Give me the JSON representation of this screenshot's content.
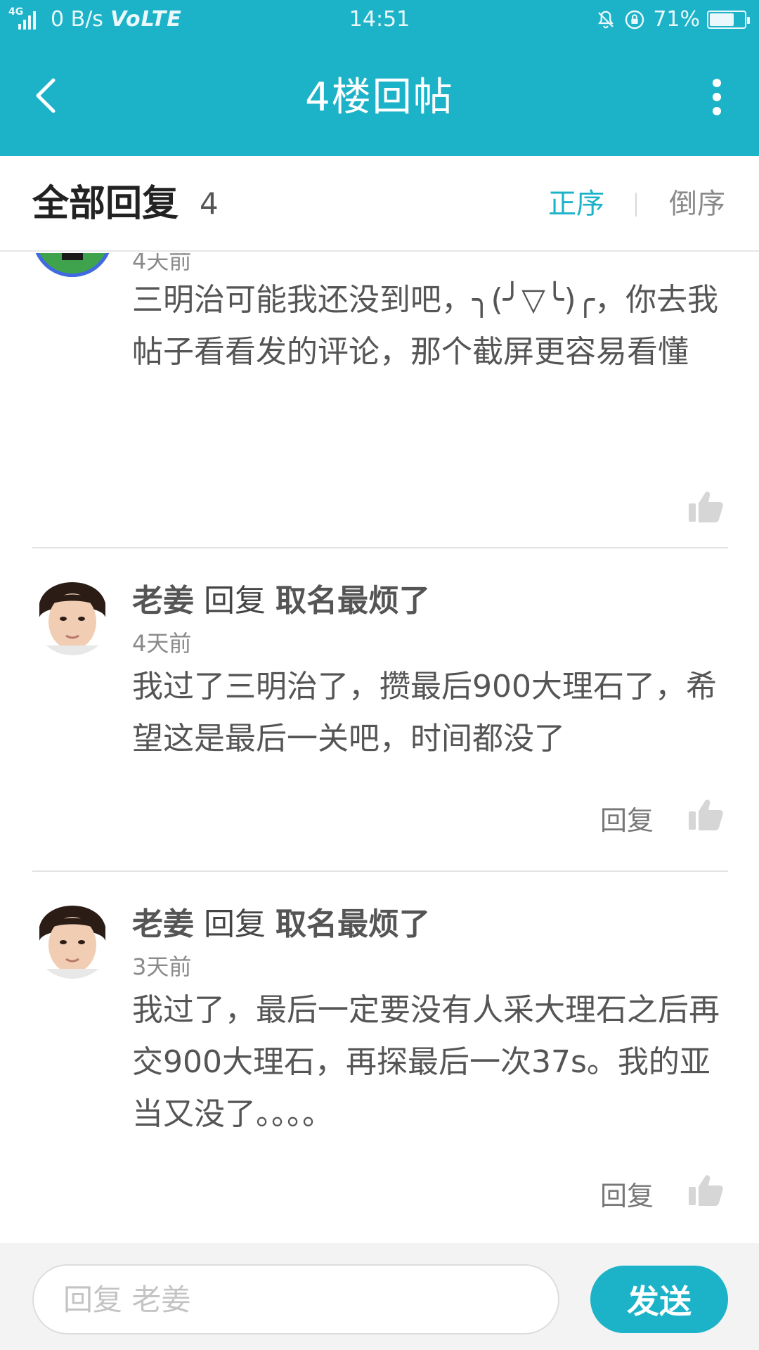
{
  "status_bar": {
    "network": "4G",
    "speed": "0 B/s",
    "volte": "VoLTE",
    "time": "14:51",
    "battery_percent": "71%",
    "battery_level": 0.71
  },
  "app_bar": {
    "title": "4楼回帖"
  },
  "header": {
    "title": "全部回复",
    "count": "4",
    "sort_asc": "正序",
    "sort_desc": "倒序"
  },
  "comments": [
    {
      "author": "",
      "reply_word": "",
      "target": "",
      "time": "4天前",
      "body": "三明治可能我还没到吧，╮(╯▽╰)╭，你去我帖子看看发的评论，那个截屏更容易看懂",
      "reply_label": ""
    },
    {
      "author": "老姜",
      "reply_word": "回复",
      "target": "取名最烦了",
      "time": "4天前",
      "body": "我过了三明治了，攒最后900大理石了，希望这是最后一关吧，时间都没了",
      "reply_label": "回复"
    },
    {
      "author": "老姜",
      "reply_word": "回复",
      "target": "取名最烦了",
      "time": "3天前",
      "body": "我过了，最后一定要没有人采大理石之后再交900大理石，再探最后一次37s。我的亚当又没了。。。。",
      "reply_label": "回复"
    }
  ],
  "input_bar": {
    "placeholder": "回复 老姜",
    "send_label": "发送"
  }
}
